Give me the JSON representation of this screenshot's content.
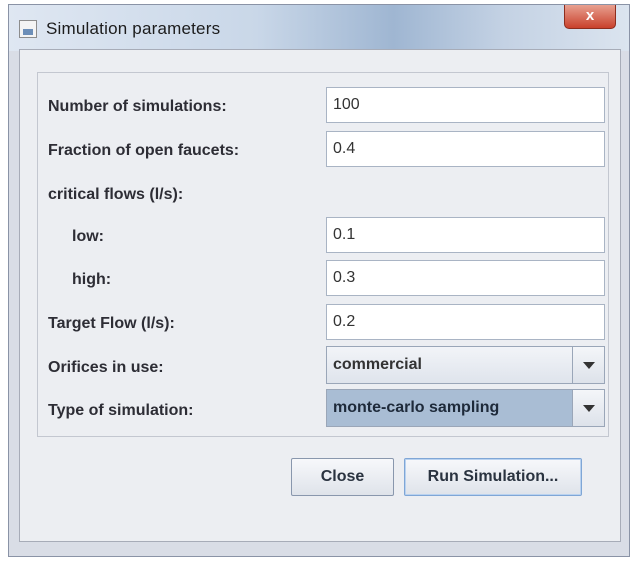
{
  "window": {
    "title": "Simulation parameters",
    "close_label": "x"
  },
  "form": {
    "num_sim_label": "Number of simulations:",
    "num_sim_value": "100",
    "fraction_label": "Fraction of open faucets:",
    "fraction_value": "0.4",
    "critical_label": "critical flows (l/s):",
    "low_label": "low:",
    "low_value": "0.1",
    "high_label": "high:",
    "high_value": "0.3",
    "target_label": "Target Flow (l/s):",
    "target_value": "0.2",
    "orifices_label": "Orifices in use:",
    "orifices_value": "commercial",
    "simtype_label": "Type of simulation:",
    "simtype_value": "monte-carlo sampling"
  },
  "buttons": {
    "close": "Close",
    "run": "Run Simulation..."
  },
  "icons": {
    "app": "window-app-icon",
    "close": "close-icon",
    "dropdown": "chevron-down-icon"
  }
}
